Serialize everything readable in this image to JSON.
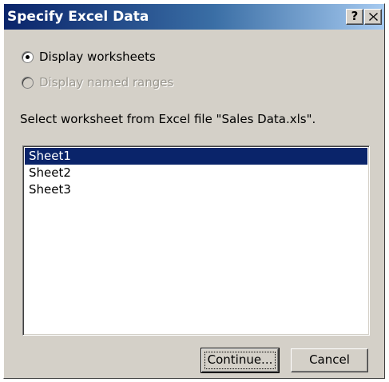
{
  "window": {
    "title": "Specify Excel Data",
    "help_label": "?",
    "titlebar_colors": {
      "start": "#0a246a",
      "end": "#a6caf0"
    }
  },
  "options": {
    "display_worksheets": {
      "label": "Display worksheets",
      "selected": true,
      "enabled": true
    },
    "display_named_ranges": {
      "label": "Display named ranges",
      "selected": false,
      "enabled": false
    }
  },
  "instruction": "Select worksheet from Excel file \"Sales Data.xls\".",
  "worksheet_list": {
    "items": [
      "Sheet1",
      "Sheet2",
      "Sheet3"
    ],
    "selected": "Sheet1",
    "selection_color": "#0a246a"
  },
  "buttons": {
    "continue_label": "Continue...",
    "cancel_label": "Cancel"
  },
  "icons": {
    "help": "help-icon",
    "close": "close-icon"
  }
}
